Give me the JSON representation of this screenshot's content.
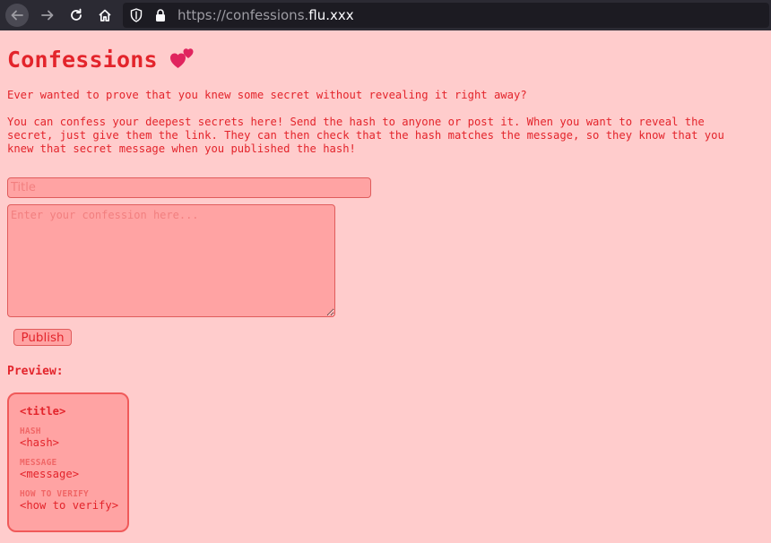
{
  "browser": {
    "url_prefix": "https://confessions.",
    "url_domain": "flu.xxx"
  },
  "page": {
    "title": "Confessions",
    "intro": "Ever wanted to prove that you knew some secret without revealing it right away?",
    "description": "You can confess your deepest secrets here! Send the hash to anyone or post it. When you want to reveal the\nsecret, just give them the link. They can then check that the hash matches the message, so they know that you\nknew that secret message when you published the hash!"
  },
  "form": {
    "title_placeholder": "Title",
    "title_value": "",
    "confession_placeholder": "Enter your confession here...",
    "confession_value": "",
    "publish_label": "Publish"
  },
  "preview": {
    "label": "Preview:",
    "title": "<title>",
    "hash_label": "HASH",
    "hash_value": "<hash>",
    "message_label": "MESSAGE",
    "message_value": "<message>",
    "verify_label": "HOW TO VERIFY",
    "verify_value": "<how to verify>"
  },
  "colors": {
    "background": "#ffcccc",
    "text": "#e3242b",
    "input_bg": "#ffa3a3",
    "browser_chrome": "#2b2a33"
  },
  "icons": [
    "back-arrow-icon",
    "forward-arrow-icon",
    "reload-icon",
    "home-icon",
    "shield-icon",
    "lock-icon",
    "two-hearts-icon"
  ]
}
